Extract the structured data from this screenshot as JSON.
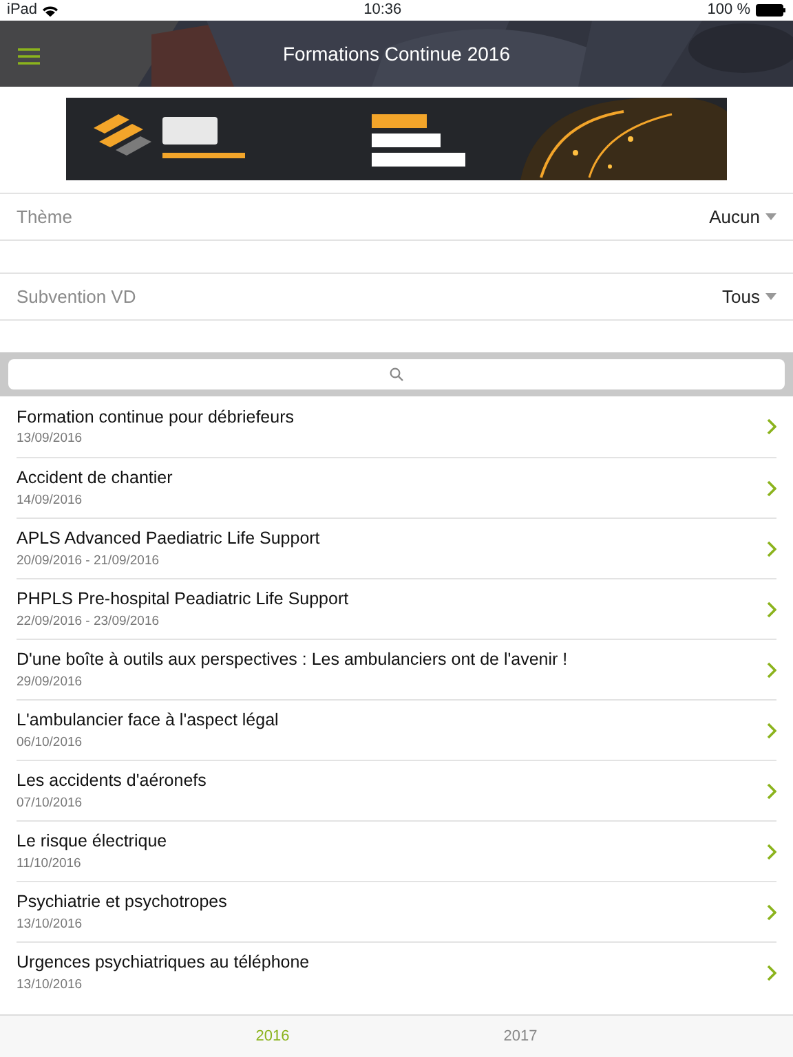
{
  "status_bar": {
    "device": "iPad",
    "time": "10:36",
    "battery": "100 %"
  },
  "header": {
    "title": "Formations Continue 2016"
  },
  "filters": [
    {
      "label": "Thème",
      "value": "Aucun"
    },
    {
      "label": "Subvention VD",
      "value": "Tous"
    }
  ],
  "courses": [
    {
      "title": "Formation continue pour débriefeurs",
      "date": "13/09/2016"
    },
    {
      "title": "Accident de chantier",
      "date": "14/09/2016"
    },
    {
      "title": "APLS Advanced Paediatric Life Support",
      "date": "20/09/2016 - 21/09/2016"
    },
    {
      "title": "PHPLS Pre-hospital Peadiatric Life Support",
      "date": "22/09/2016 - 23/09/2016"
    },
    {
      "title": "D'une boîte à outils aux perspectives : Les ambulanciers ont de l'avenir !",
      "date": "29/09/2016"
    },
    {
      "title": "L'ambulancier face à l'aspect légal",
      "date": "06/10/2016"
    },
    {
      "title": "Les accidents d'aéronefs",
      "date": "07/10/2016"
    },
    {
      "title": "Le risque électrique",
      "date": "11/10/2016"
    },
    {
      "title": "Psychiatrie et psychotropes",
      "date": "13/10/2016"
    },
    {
      "title": "Urgences psychiatriques au téléphone",
      "date": "13/10/2016"
    }
  ],
  "tabs": [
    {
      "label": "2016",
      "selected": true
    },
    {
      "label": "2017",
      "selected": false
    }
  ]
}
